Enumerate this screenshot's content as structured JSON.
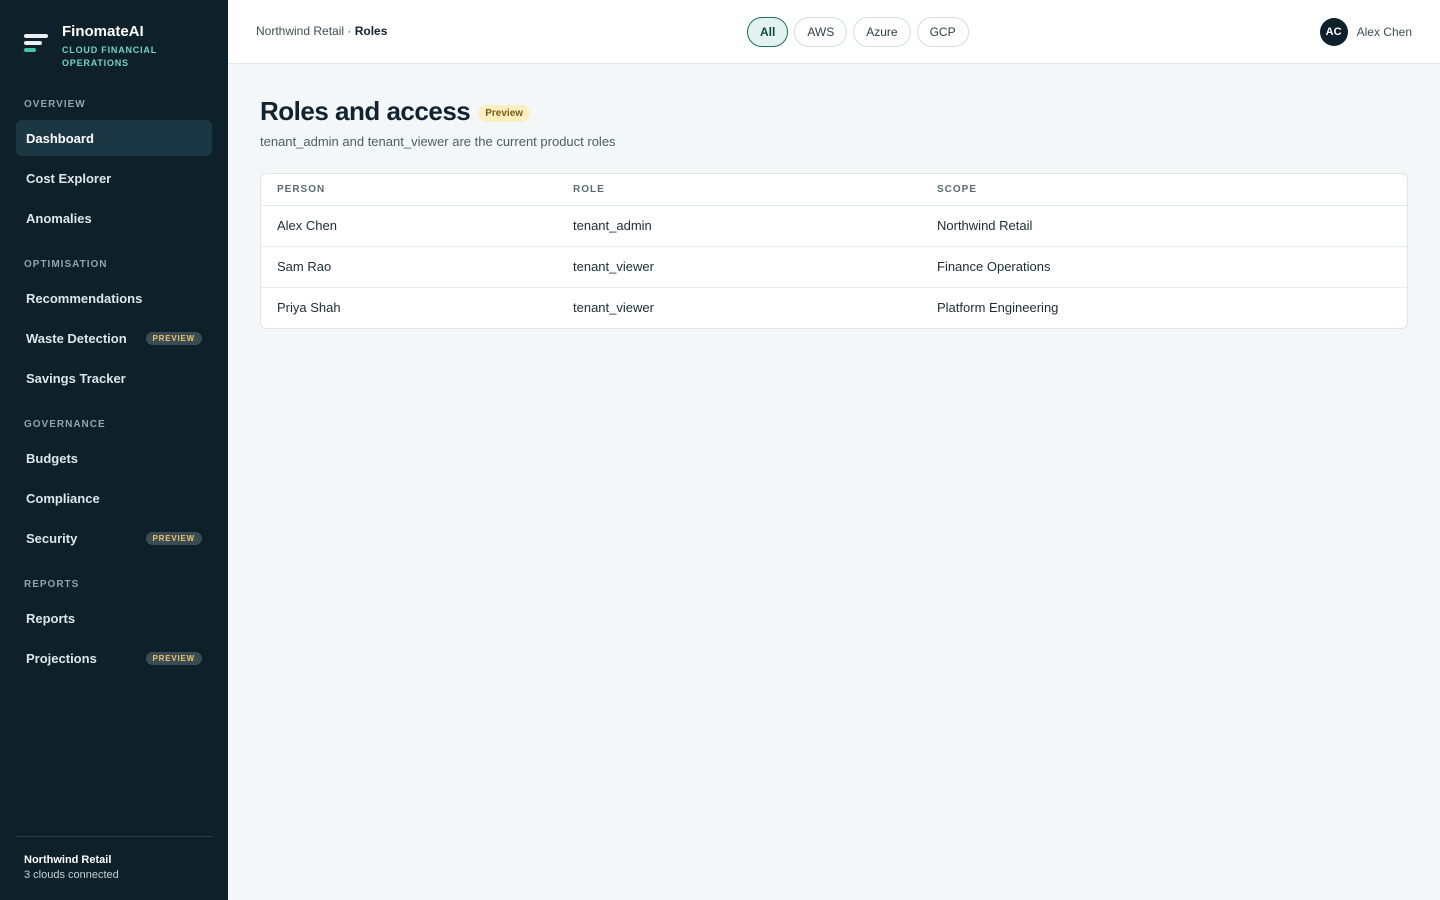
{
  "brand": {
    "name": "FinomateAI",
    "tagline": "CLOUD FINANCIAL OPERATIONS"
  },
  "sidebar": {
    "sections": [
      {
        "label": "OVERVIEW"
      },
      {
        "label": "OPTIMISATION"
      },
      {
        "label": "GOVERNANCE"
      },
      {
        "label": "REPORTS"
      }
    ],
    "items": [
      {
        "label": "Dashboard",
        "active": true
      },
      {
        "label": "Cost Explorer"
      },
      {
        "label": "Anomalies"
      },
      {
        "label": "Recommendations"
      },
      {
        "label": "Waste Detection",
        "badge": "PREVIEW"
      },
      {
        "label": "Savings Tracker"
      },
      {
        "label": "Budgets"
      },
      {
        "label": "Compliance"
      },
      {
        "label": "Security",
        "badge": "PREVIEW"
      },
      {
        "label": "Reports"
      },
      {
        "label": "Projections",
        "badge": "PREVIEW"
      }
    ],
    "footer": {
      "org": "Northwind Retail",
      "status": "3 clouds connected"
    }
  },
  "topbar": {
    "breadcrumb": {
      "parent": "Northwind Retail",
      "separator": " · ",
      "current": "Roles"
    },
    "cloud_filters": [
      {
        "label": "All",
        "active": true
      },
      {
        "label": "AWS"
      },
      {
        "label": "Azure"
      },
      {
        "label": "GCP"
      }
    ],
    "user": {
      "initials": "AC",
      "name": "Alex Chen"
    }
  },
  "main": {
    "title": "Roles and access",
    "title_badge": "Preview",
    "subtitle": "tenant_admin and tenant_viewer are the current product roles",
    "table": {
      "columns": [
        "PERSON",
        "ROLE",
        "SCOPE"
      ],
      "rows": [
        {
          "person": "Alex Chen",
          "role": "tenant_admin",
          "scope": "Northwind Retail"
        },
        {
          "person": "Sam Rao",
          "role": "tenant_viewer",
          "scope": "Finance Operations"
        },
        {
          "person": "Priya Shah",
          "role": "tenant_viewer",
          "scope": "Platform Engineering"
        }
      ]
    }
  },
  "colors": {
    "sidebar_bg": "#0e202a",
    "accent": "#3fc4b0",
    "badge_text": "#e9c46a"
  }
}
